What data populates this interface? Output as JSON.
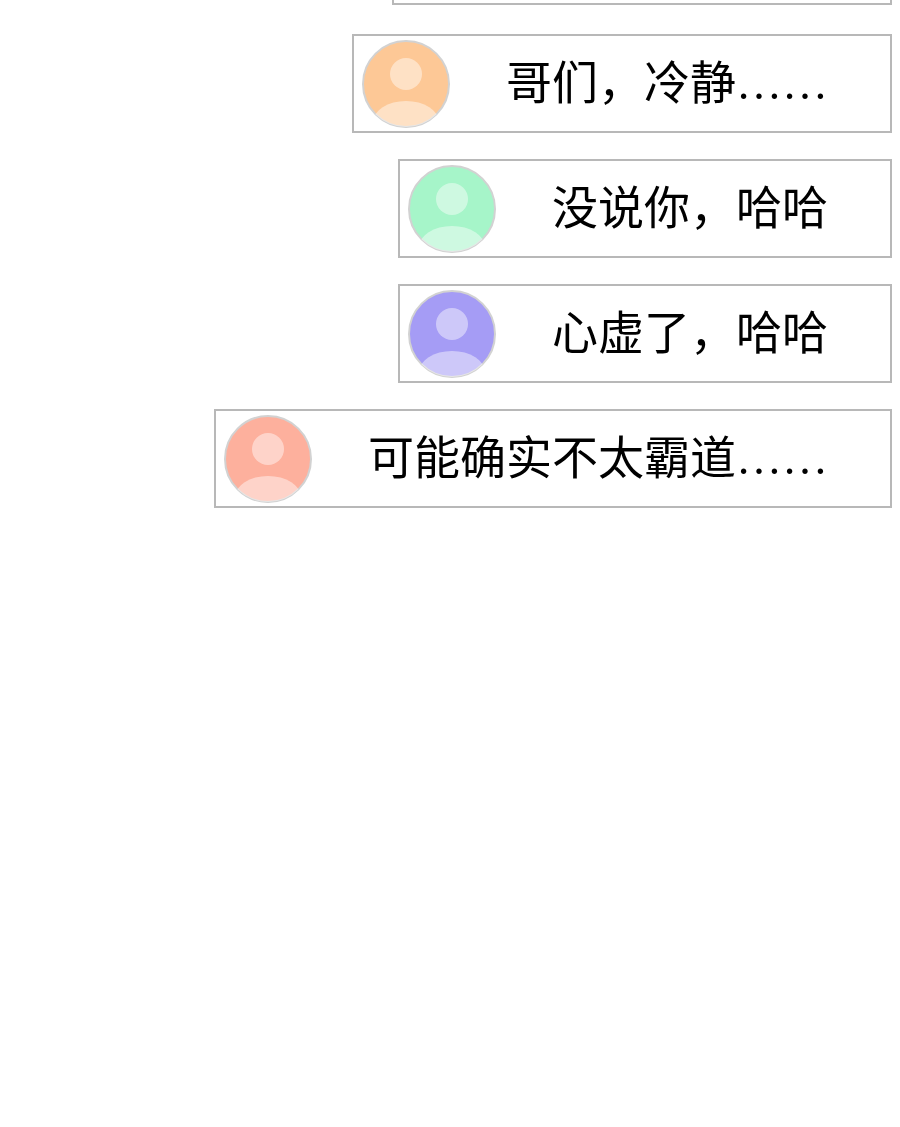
{
  "messages": [
    {
      "text": "哥们，冷静……",
      "color": "#fdc896"
    },
    {
      "text": "没说你，哈哈",
      "color": "#a6f5c9"
    },
    {
      "text": "心虚了，哈哈",
      "color": "#a59cf5"
    },
    {
      "text": "可能确实不太霸道……",
      "color": "#fdb09d"
    }
  ]
}
